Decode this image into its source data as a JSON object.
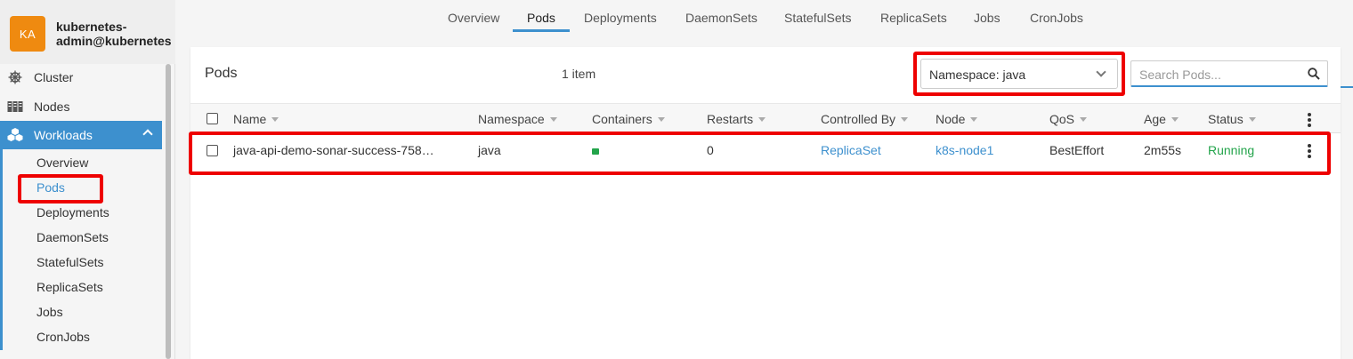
{
  "cluster": {
    "initials": "KA",
    "name_line1": "kubernetes-",
    "name_line2": "admin@kubernetes"
  },
  "sidebar": {
    "items": [
      {
        "label": "Cluster",
        "icon": "helm-wheel-icon"
      },
      {
        "label": "Nodes",
        "icon": "server-rack-icon"
      },
      {
        "label": "Workloads",
        "icon": "cubes-icon"
      }
    ],
    "workload_subitems": [
      "Overview",
      "Pods",
      "Deployments",
      "DaemonSets",
      "StatefulSets",
      "ReplicaSets",
      "Jobs",
      "CronJobs"
    ],
    "active_subitem": "Pods"
  },
  "tabs": [
    "Overview",
    "Pods",
    "Deployments",
    "DaemonSets",
    "StatefulSets",
    "ReplicaSets",
    "Jobs",
    "CronJobs"
  ],
  "active_tab": "Pods",
  "main": {
    "title": "Pods",
    "item_count": "1 item",
    "namespace_select": "Namespace: java",
    "search_placeholder": "Search Pods...",
    "columns": [
      "Name",
      "Namespace",
      "Containers",
      "Restarts",
      "Controlled By",
      "Node",
      "QoS",
      "Age",
      "Status"
    ],
    "rows": [
      {
        "name": "java-api-demo-sonar-success-758…",
        "namespace": "java",
        "restarts": "0",
        "controlled_by": "ReplicaSet",
        "node": "k8s-node1",
        "qos": "BestEffort",
        "age": "2m55s",
        "status": "Running"
      }
    ]
  },
  "colors": {
    "accent": "#3d90ce",
    "running": "#23a44b",
    "avatar": "#ef8a10",
    "highlight": "#e00000"
  }
}
